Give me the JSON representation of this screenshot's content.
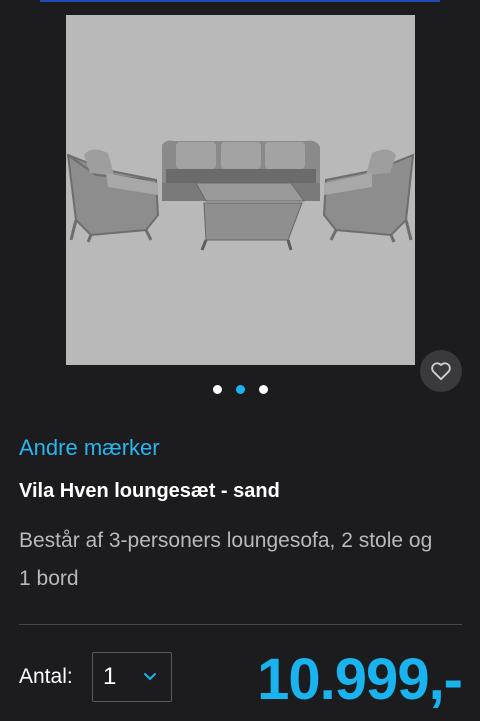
{
  "product": {
    "image_alt_icon": "lounge-set-image",
    "brand": "Andre mærker",
    "title": "Vila Hven loungesæt - sand",
    "description": "Består af 3-personers loungesofa, 2 stole og 1 bord",
    "price": "10.999,-"
  },
  "gallery": {
    "dots": 3,
    "active_index": 1
  },
  "quantity": {
    "label": "Antal:",
    "value": "1"
  },
  "colors": {
    "accent": "#19b4f0",
    "background": "#1c1c1e"
  }
}
